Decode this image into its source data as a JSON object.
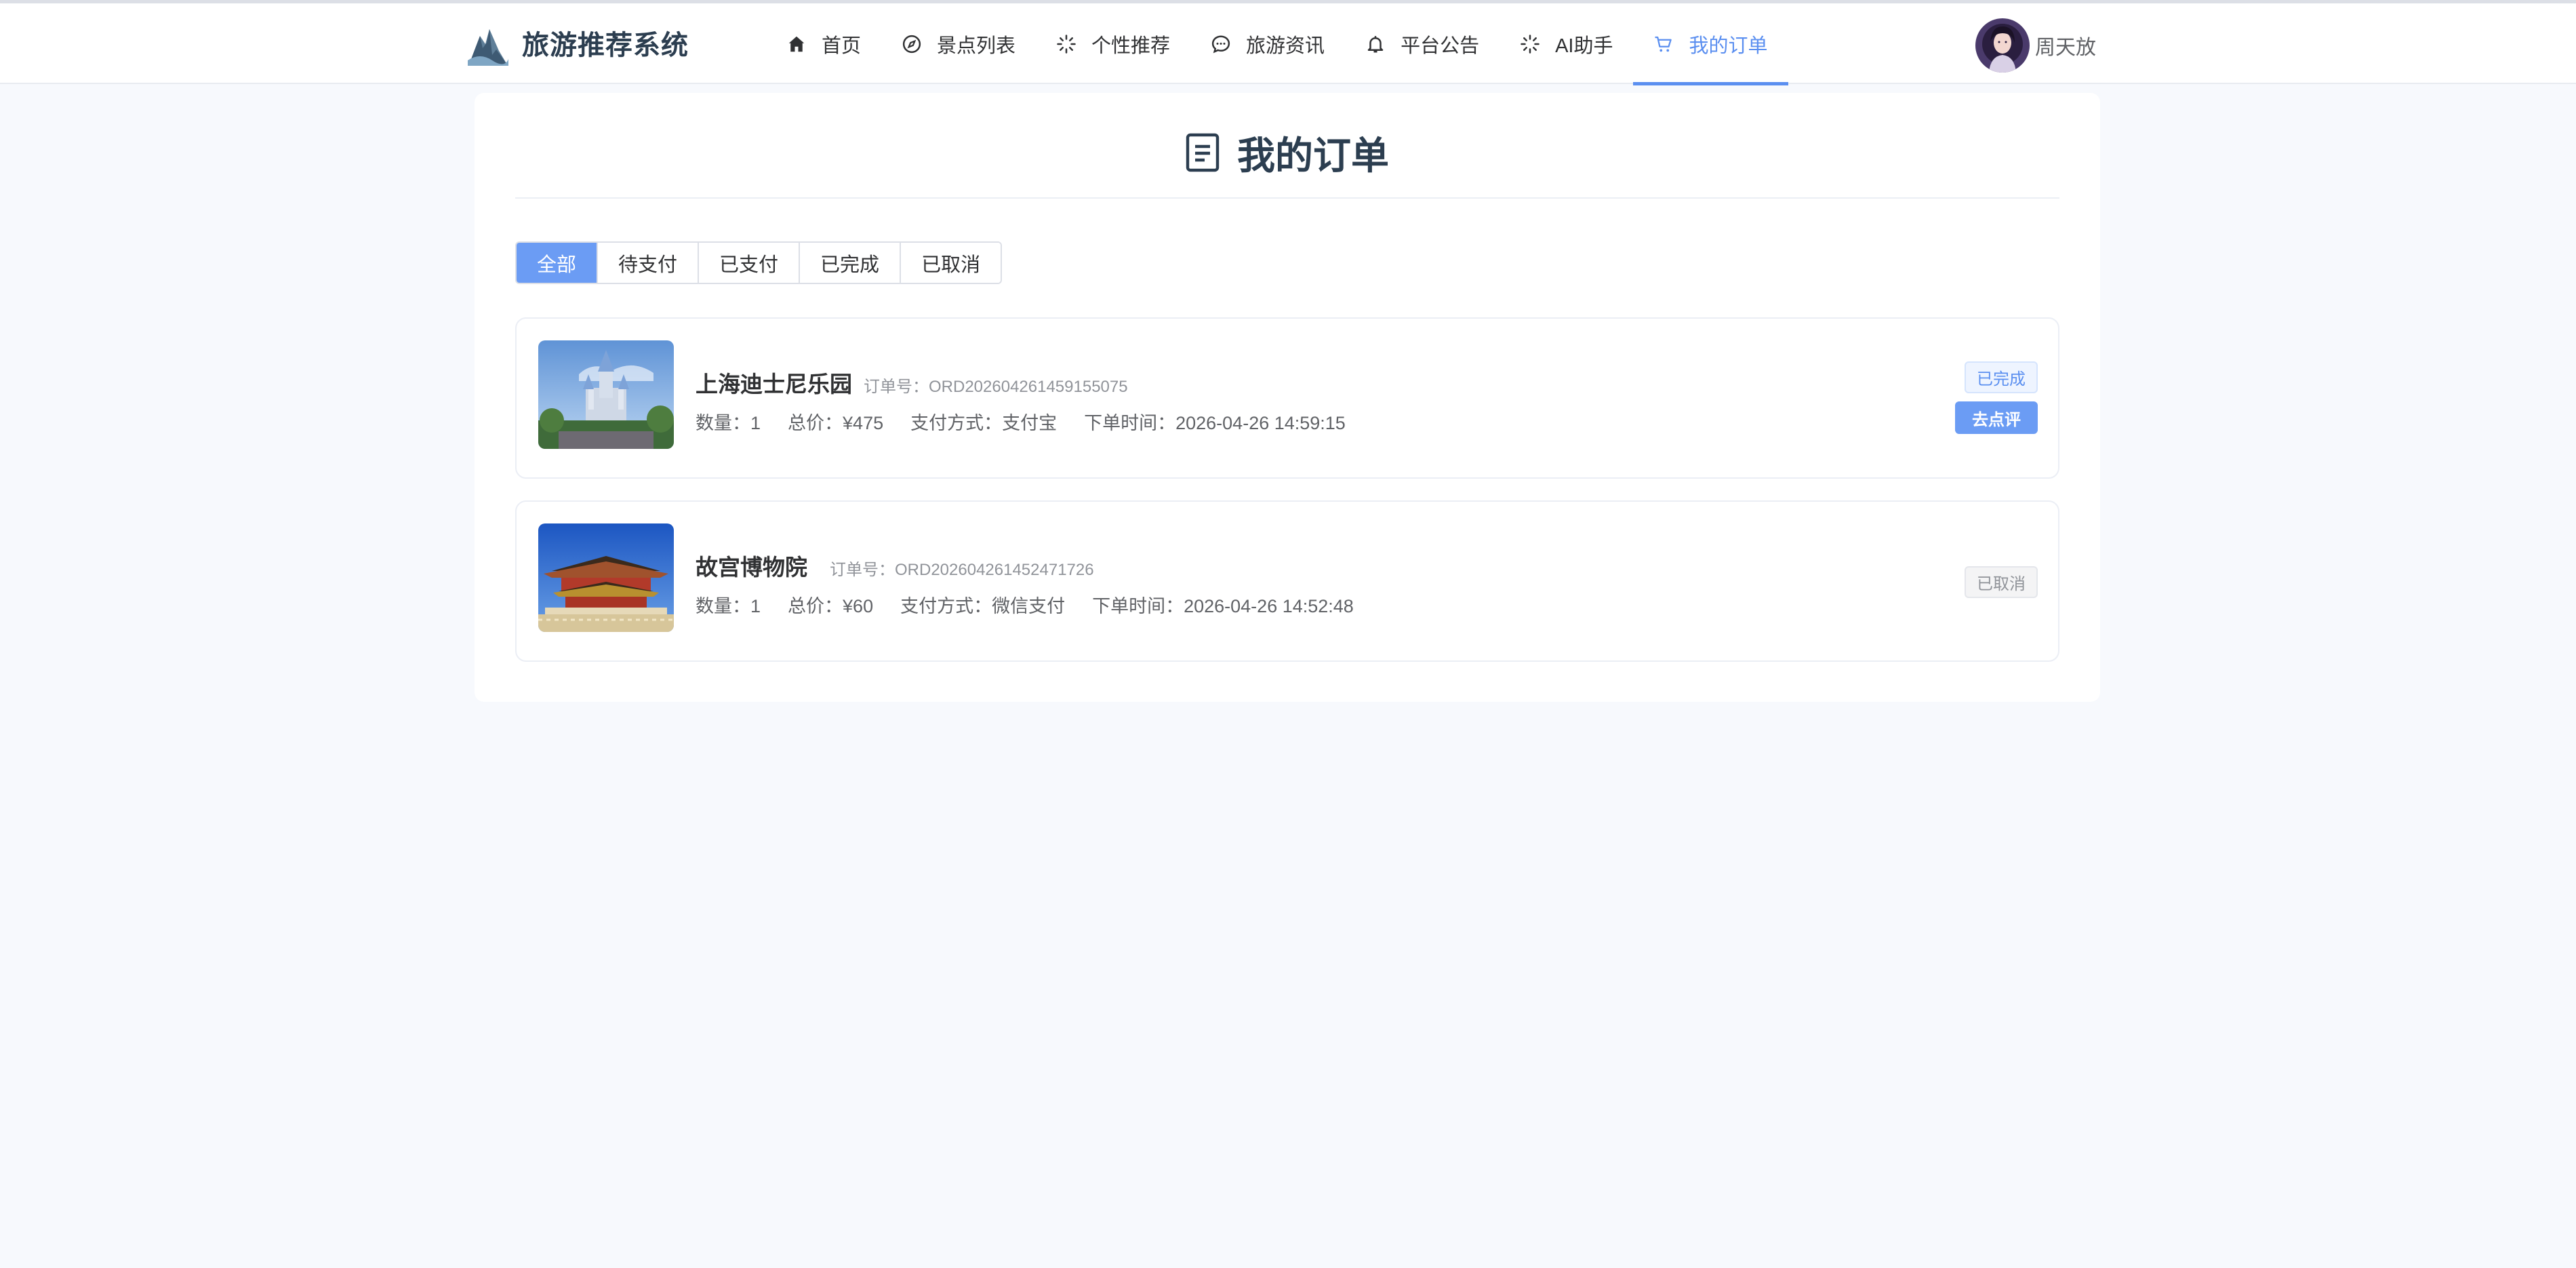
{
  "header": {
    "site_title": "旅游推荐系统",
    "nav": [
      {
        "label": "首页",
        "icon": "home-icon"
      },
      {
        "label": "景点列表",
        "icon": "compass-icon"
      },
      {
        "label": "个性推荐",
        "icon": "loading-icon"
      },
      {
        "label": "旅游资讯",
        "icon": "chat-icon"
      },
      {
        "label": "平台公告",
        "icon": "bell-icon"
      },
      {
        "label": "AI助手",
        "icon": "loading-icon"
      },
      {
        "label": "我的订单",
        "icon": "cart-icon",
        "active": true
      }
    ],
    "user_name": "周天放"
  },
  "page": {
    "title": "我的订单",
    "tabs": [
      "全部",
      "待支付",
      "已支付",
      "已完成",
      "已取消"
    ],
    "active_tab": "全部"
  },
  "orders": [
    {
      "name": "上海迪士尼乐园",
      "order_no_label": "订单号：",
      "order_no": "ORD202604261459155075",
      "quantity": "数量：1",
      "total": "总价：¥475",
      "payment": "支付方式：支付宝",
      "time": "下单时间：2026-04-26 14:59:15",
      "status": "已完成",
      "action": "去点评"
    },
    {
      "name": "故宫博物院",
      "order_no_label": "订单号：",
      "order_no": "ORD202604261452471726",
      "quantity": "数量：1",
      "total": "总价：¥60",
      "payment": "支付方式：微信支付",
      "time": "下单时间：2026-04-26 14:52:48",
      "status": "已取消"
    }
  ],
  "colors": {
    "accent": "#6b9cf4",
    "background": "#f7f9fd"
  }
}
